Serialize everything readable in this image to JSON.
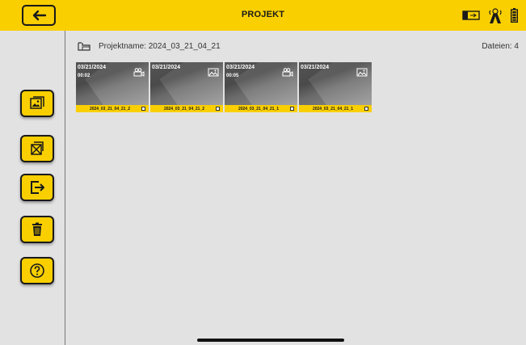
{
  "header": {
    "title": "PROJEKT",
    "background": "#f9cf00",
    "back_icon": "arrow-left-icon",
    "status_icons": [
      "usb-stick-icon",
      "signal-tower-icon",
      "battery-icon"
    ]
  },
  "sidebar": {
    "buttons": [
      {
        "name": "gallery-button",
        "icon": "picture-frame-icon"
      },
      {
        "name": "deselect-button",
        "icon": "crossed-box-icon"
      },
      {
        "name": "export-button",
        "icon": "export-arrow-icon"
      },
      {
        "name": "delete-button",
        "icon": "trash-icon"
      },
      {
        "name": "help-button",
        "icon": "question-mark-icon"
      }
    ]
  },
  "project": {
    "label": "Projektname: 2024_03_21_04_21",
    "file_count": "Dateien: 4"
  },
  "files": [
    {
      "date": "03/21/2024",
      "sub": "00:02",
      "type": "video",
      "label": "2024_03_21_04_21_2",
      "selected": false
    },
    {
      "date": "03/21/2024",
      "sub": "",
      "type": "image",
      "label": "2024_03_21_04_21_2",
      "selected": false
    },
    {
      "date": "03/21/2024",
      "sub": "00:05",
      "type": "video",
      "label": "2024_03_21_04_21_1",
      "selected": false
    },
    {
      "date": "03/21/2024",
      "sub": "",
      "type": "image",
      "label": "2024_03_21_04_21_1",
      "selected": false
    }
  ]
}
